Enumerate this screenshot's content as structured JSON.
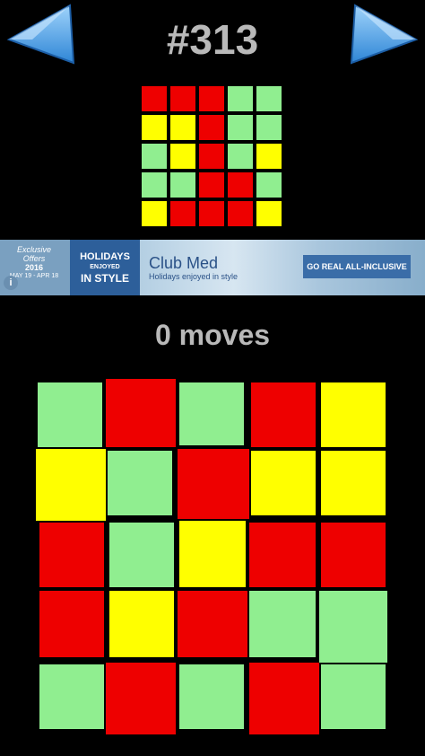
{
  "header": {
    "level_title": "#313",
    "prev_icon": "triangle-left-icon",
    "next_icon": "triangle-right-icon"
  },
  "colors": {
    "red": "#ee0000",
    "yellow": "#ffff00",
    "green": "#90ee90",
    "background": "#000000",
    "text": "#b9b9b9",
    "arrow": "#4da6ea"
  },
  "target_grid": [
    [
      "red",
      "red",
      "red",
      "green",
      "green"
    ],
    [
      "yellow",
      "yellow",
      "red",
      "green",
      "green"
    ],
    [
      "green",
      "yellow",
      "red",
      "green",
      "yellow"
    ],
    [
      "green",
      "green",
      "red",
      "red",
      "green"
    ],
    [
      "yellow",
      "red",
      "red",
      "red",
      "yellow"
    ]
  ],
  "ad": {
    "badge_line1": "Exclusive Offers",
    "badge_line2": "2016",
    "badge_line3": "MAY 19 - APR 18",
    "holidays_line1": "HOLIDAYS",
    "holidays_line2": "ENJOYED",
    "holidays_line3": "IN STYLE",
    "brand": "Club Med",
    "tagline": "Holidays enjoyed in style",
    "cta": "GO REAL ALL-INCLUSIVE",
    "info_icon": "info-icon"
  },
  "status": {
    "moves": "0 moves"
  },
  "play_grid": [
    [
      "green",
      "red",
      "green",
      "red",
      "yellow"
    ],
    [
      "yellow",
      "green",
      "red",
      "yellow",
      "yellow"
    ],
    [
      "red",
      "green",
      "yellow",
      "red",
      "red"
    ],
    [
      "red",
      "yellow",
      "red",
      "green",
      "green"
    ],
    [
      "green",
      "red",
      "green",
      "red",
      "green"
    ]
  ]
}
